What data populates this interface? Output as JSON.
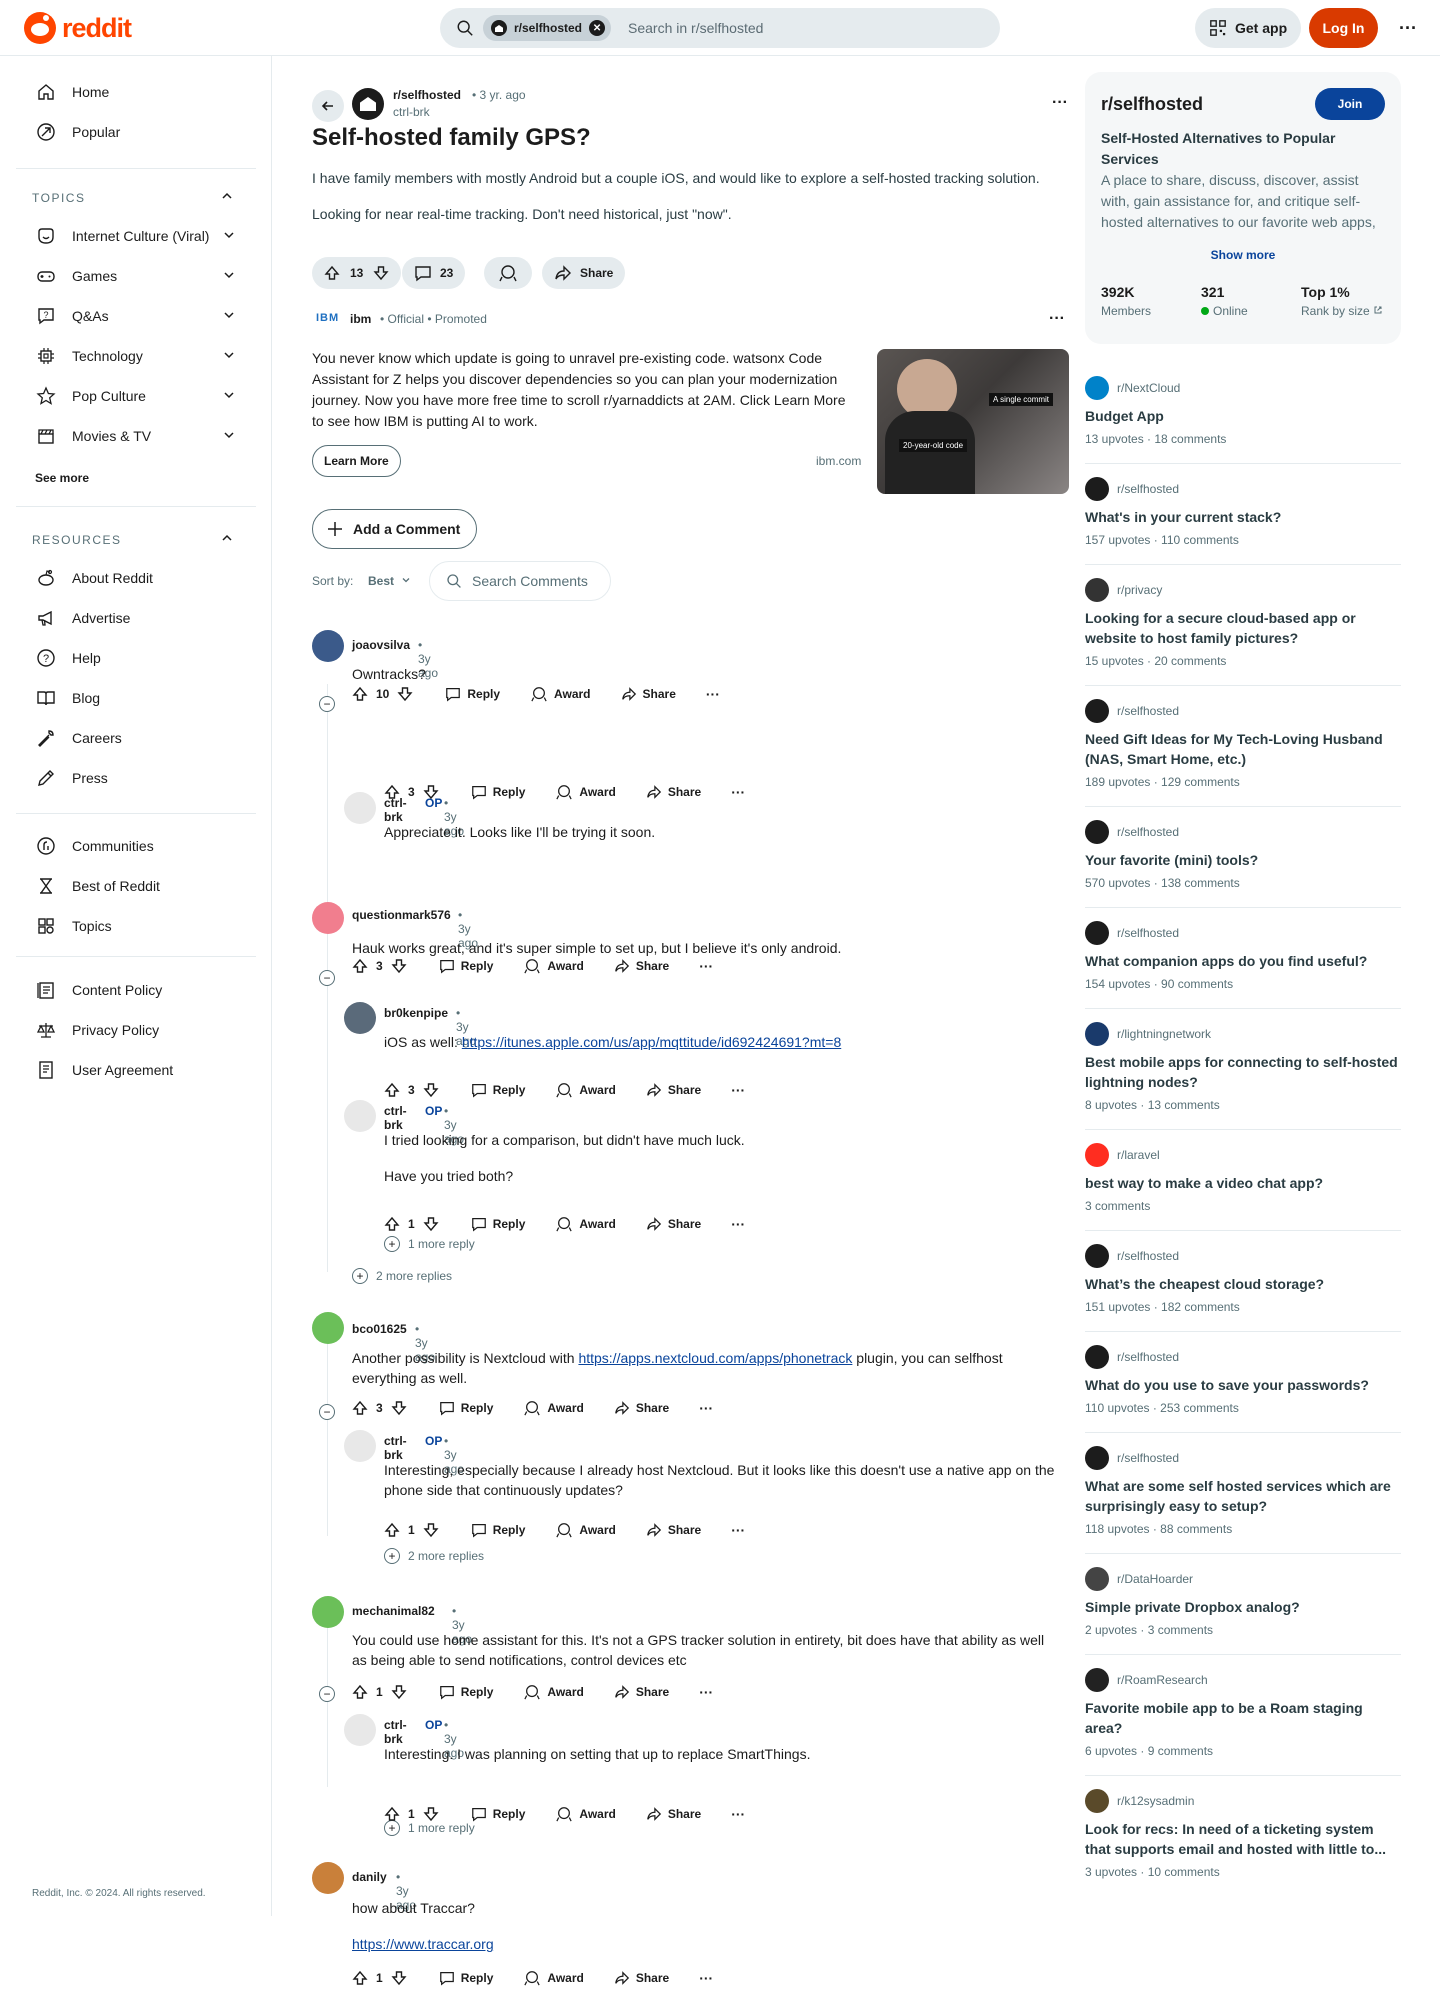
{
  "header": {
    "logo_text": "reddit",
    "search_chip": "r/selfhosted",
    "search_placeholder": "Search in r/selfhosted",
    "get_app": "Get app",
    "login": "Log In"
  },
  "sidebar": {
    "main": [
      {
        "label": "Home",
        "icon": "home-icon"
      },
      {
        "label": "Popular",
        "icon": "popular-icon"
      }
    ],
    "topics_header": "TOPICS",
    "topics": [
      {
        "label": "Internet Culture (Viral)",
        "icon": "smile-icon"
      },
      {
        "label": "Games",
        "icon": "gamepad-icon"
      },
      {
        "label": "Q&As",
        "icon": "question-icon"
      },
      {
        "label": "Technology",
        "icon": "chip-icon"
      },
      {
        "label": "Pop Culture",
        "icon": "star-icon"
      },
      {
        "label": "Movies & TV",
        "icon": "clapper-icon"
      }
    ],
    "see_more": "See more",
    "resources_header": "RESOURCES",
    "resources": [
      {
        "label": "About Reddit",
        "icon": "reddit-icon"
      },
      {
        "label": "Advertise",
        "icon": "megaphone-icon"
      },
      {
        "label": "Help",
        "icon": "help-icon"
      },
      {
        "label": "Blog",
        "icon": "book-icon"
      },
      {
        "label": "Careers",
        "icon": "wrench-icon"
      },
      {
        "label": "Press",
        "icon": "pen-icon"
      }
    ],
    "community": [
      {
        "label": "Communities",
        "icon": "communities-icon"
      },
      {
        "label": "Best of Reddit",
        "icon": "hourglass-icon"
      },
      {
        "label": "Topics",
        "icon": "grid-icon"
      }
    ],
    "policies": [
      {
        "label": "Content Policy",
        "icon": "policy-icon"
      },
      {
        "label": "Privacy Policy",
        "icon": "scale-icon"
      },
      {
        "label": "User Agreement",
        "icon": "agreement-icon"
      }
    ],
    "copyright": "Reddit, Inc. © 2024. All rights reserved."
  },
  "post": {
    "subreddit": "r/selfhosted",
    "time": "• 3 yr. ago",
    "author": "ctrl-brk",
    "title": "Self-hosted family GPS?",
    "body": [
      "I have family members with mostly Android but a couple iOS, and would like to explore a self-hosted tracking solution.",
      "Looking for near real-time tracking. Don't need historical, just \"now\"."
    ],
    "votes": "13",
    "comments": "23",
    "share": "Share"
  },
  "ad": {
    "logo": "IBM",
    "name": "ibm",
    "meta": "• Official  •  Promoted",
    "text": "You never know which update is going to unravel pre-existing code. watsonx Code Assistant for Z helps you discover dependencies so you can plan your modernization journey. Now you have more free time to scroll r/yarnaddicts at 2AM. Click Learn More to see how IBM is putting AI to work.",
    "button": "Learn More",
    "domain": "ibm.com",
    "img_tag1": "A single commit",
    "img_tag2": "20-year-old code"
  },
  "comments_bar": {
    "add": "Add a Comment",
    "sort_label": "Sort by:",
    "sort_value": "Best",
    "search": "Search Comments"
  },
  "actions": {
    "reply": "Reply",
    "award": "Award",
    "share": "Share"
  },
  "comments": [
    {
      "user": "joaovsilva",
      "time": "• 3y ago",
      "text": "Owntracks?",
      "votes": "10"
    },
    {
      "user": "ctrl-brk",
      "op": "OP",
      "time": "• 3y ago",
      "text": "Appreciate it. Looks like I'll be trying it soon.",
      "votes": "3"
    },
    {
      "user": "questionmark576",
      "time": "• 3y ago",
      "text": "Hauk works great, and it's super simple to set up, but I believe it's only android.",
      "votes": "3"
    },
    {
      "user": "br0kenpipe",
      "time": "• 3y ago",
      "text_prefix": "iOS as well: ",
      "link": "https://itunes.apple.com/us/app/mqttitude/id692424691?mt=8",
      "votes": "3"
    },
    {
      "user": "ctrl-brk",
      "op": "OP",
      "time": "• 3y ago",
      "text": "I tried looking for a comparison, but didn't have much luck.",
      "text2": "Have you tried both?",
      "votes": "1",
      "more": "1 more reply"
    },
    {
      "more_outer": "2 more replies"
    },
    {
      "user": "bco01625",
      "time": "• 3y ago",
      "text_prefix": "Another possibility is Nextcloud with ",
      "link": "https://apps.nextcloud.com/apps/phonetrack",
      "text_suffix": " plugin, you can selfhost everything as well.",
      "votes": "3"
    },
    {
      "user": "ctrl-brk",
      "op": "OP",
      "time": "• 3y ago",
      "text": "Interesting, especially because I already host Nextcloud. But it looks like this doesn't use a native app on the phone side that continuously updates?",
      "votes": "1",
      "more": "2 more replies"
    },
    {
      "user": "mechanimal82",
      "time": "• 3y ago",
      "text": "You could use home assistant for this. It's not a GPS tracker solution in entirety, bit does have that ability as well as being able to send notifications, control devices etc",
      "votes": "1"
    },
    {
      "user": "ctrl-brk",
      "op": "OP",
      "time": "• 3y ago",
      "text": "Interesting. I was planning on setting that up to replace SmartThings.",
      "votes": "1",
      "more": "1 more reply"
    },
    {
      "user": "danily",
      "time": "• 3y ago",
      "text": "how about Traccar?",
      "link": "https://www.traccar.org",
      "votes": "1"
    }
  ],
  "community": {
    "name": "r/selfhosted",
    "join": "Join",
    "tagline": "Self-Hosted Alternatives to Popular Services",
    "description": "A place to share, discuss, discover, assist with, gain assistance for, and critique self-hosted alternatives to our favorite web apps, web services, and online tools.",
    "show_more": "Show more",
    "members": "392K",
    "members_label": "Members",
    "online": "321",
    "online_label": "Online",
    "rank": "Top 1%",
    "rank_label": "Rank by size"
  },
  "related": [
    {
      "sub": "r/NextCloud",
      "title": "Budget App",
      "meta": "13 upvotes  ·  18 comments",
      "color": "#0082c9"
    },
    {
      "sub": "r/selfhosted",
      "title": "What's in your current stack?",
      "meta": "157 upvotes  ·  110 comments",
      "color": "#1c1c1c"
    },
    {
      "sub": "r/privacy",
      "title": "Looking for a secure cloud-based app or website to host family pictures?",
      "meta": "15 upvotes  ·  20 comments",
      "color": "#333333"
    },
    {
      "sub": "r/selfhosted",
      "title": "Need Gift Ideas for My Tech-Loving Husband (NAS, Smart Home, etc.)",
      "meta": "189 upvotes  ·  129 comments",
      "color": "#1c1c1c"
    },
    {
      "sub": "r/selfhosted",
      "title": "Your favorite (mini) tools?",
      "meta": "570 upvotes  ·  138 comments",
      "color": "#1c1c1c"
    },
    {
      "sub": "r/selfhosted",
      "title": "What companion apps do you find useful?",
      "meta": "154 upvotes  ·  90 comments",
      "color": "#1c1c1c"
    },
    {
      "sub": "r/lightningnetwork",
      "title": "Best mobile apps for connecting to self-hosted lightning nodes?",
      "meta": "8 upvotes  ·  13 comments",
      "color": "#1a3a6b"
    },
    {
      "sub": "r/laravel",
      "title": "best way to make a video chat app?",
      "meta": "3 comments",
      "color": "#ff2d20"
    },
    {
      "sub": "r/selfhosted",
      "title": "What’s the cheapest cloud storage?",
      "meta": "151 upvotes  ·  182 comments",
      "color": "#1c1c1c"
    },
    {
      "sub": "r/selfhosted",
      "title": "What do you use to save your passwords?",
      "meta": "110 upvotes  ·  253 comments",
      "color": "#1c1c1c"
    },
    {
      "sub": "r/selfhosted",
      "title": "What are some self hosted services which are surprisingly easy to setup?",
      "meta": "118 upvotes  ·  88 comments",
      "color": "#1c1c1c"
    },
    {
      "sub": "r/DataHoarder",
      "title": "Simple private Dropbox analog?",
      "meta": "2 upvotes  ·  3 comments",
      "color": "#444444"
    },
    {
      "sub": "r/RoamResearch",
      "title": "Favorite mobile app to be a Roam staging area?",
      "meta": "6 upvotes  ·  9 comments",
      "color": "#222222"
    },
    {
      "sub": "r/k12sysadmin",
      "title": "Look for recs: In need of a ticketing system that supports email and hosted with little to...",
      "meta": "3 upvotes  ·  10 comments",
      "color": "#5a4a2a"
    }
  ]
}
